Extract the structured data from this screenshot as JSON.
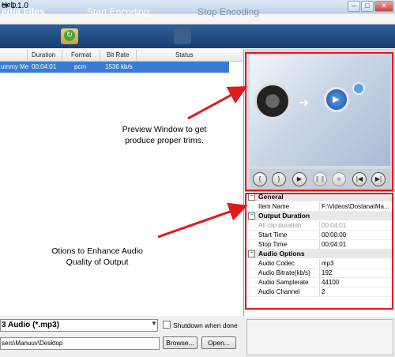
{
  "window": {
    "title_partial": "er 1.1.0"
  },
  "menu": {
    "help": "Help"
  },
  "toolbar": {
    "media_files": "edia Files",
    "start_encoding": "Start Encoding",
    "stop_encoding": "Stop Encoding"
  },
  "file_list": {
    "columns": [
      "Duration",
      "Format",
      "Bit Rate",
      "Status"
    ],
    "rows": [
      {
        "name": "ummy Me",
        "duration": "00:04:01",
        "format": "pcm",
        "bit_rate": "1536 kb/s",
        "status": ""
      }
    ]
  },
  "output": {
    "format_value": "3 Audio (*.mp3)",
    "shutdown_label": "Shutdown when done",
    "path_value": "sers\\Manuuv\\Desktop",
    "browse_label": "Browse...",
    "open_label": "Open..."
  },
  "properties": {
    "general": {
      "title": "General",
      "item_name_label": "Item Name",
      "item_name_value": "F:\\Videos\\Dostana\\Ma..."
    },
    "output_duration": {
      "title": "Output Duration",
      "all_clip_label": "All clip duration",
      "all_clip_value": "00:04:01",
      "start_label": "Start Time",
      "start_value": "00:00:00",
      "stop_label": "Stop Time",
      "stop_value": "00:04:01"
    },
    "audio_options": {
      "title": "Audio Options",
      "codec_label": "Audio Codec",
      "codec_value": "mp3",
      "bitrate_label": "Audio Bitrate(kb/s)",
      "bitrate_value": "192",
      "samplerate_label": "Audio Samplerate",
      "samplerate_value": "44100",
      "channel_label": "Audio Channel",
      "channel_value": "2"
    }
  },
  "annotations": {
    "preview_line1": "Preview Window to get",
    "preview_line2": "produce proper trims.",
    "options_line1": "Otions to Enhance Audio",
    "options_line2": "Quality of Output"
  },
  "colors": {
    "annotation_red": "#e0191b",
    "toolbar": "#1f4a82",
    "selection": "#3a7bd5"
  }
}
